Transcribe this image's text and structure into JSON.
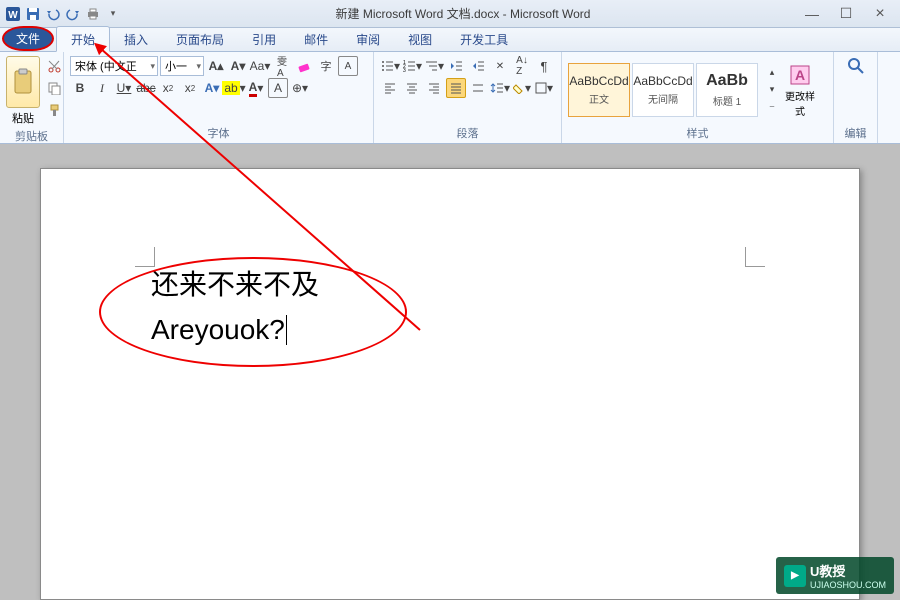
{
  "titlebar": {
    "title": "新建 Microsoft Word 文档.docx - Microsoft Word"
  },
  "tabs": {
    "file": "文件",
    "home": "开始",
    "insert": "插入",
    "layout": "页面布局",
    "references": "引用",
    "mailings": "邮件",
    "review": "审阅",
    "view": "视图",
    "developer": "开发工具"
  },
  "ribbon": {
    "clipboard": {
      "paste": "粘贴",
      "label": "剪贴板"
    },
    "font": {
      "name": "宋体 (中文正",
      "size": "小一",
      "label": "字体"
    },
    "paragraph": {
      "label": "段落"
    },
    "styles": {
      "preview": "AaBbCcDd",
      "preview_big": "AaBb",
      "normal": "正文",
      "nospacing": "无间隔",
      "heading1": "标题 1",
      "change": "更改样式",
      "label": "样式"
    },
    "editing": {
      "label": "编辑"
    }
  },
  "document": {
    "line1": "还来不来不及",
    "line2": "Areyouok?"
  },
  "watermark": {
    "name": "U教授",
    "url": "UJIAOSHOU.COM"
  }
}
